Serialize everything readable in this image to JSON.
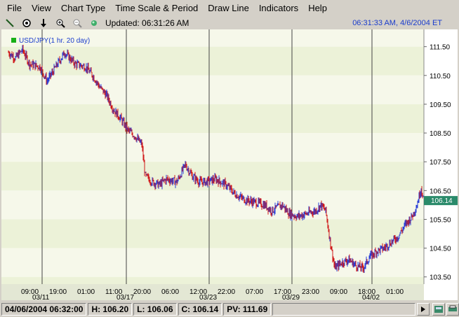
{
  "menu": [
    "File",
    "View",
    "Chart Type",
    "Time Scale & Period",
    "Draw Line",
    "Indicators",
    "Help"
  ],
  "toolbar": {
    "updated": "Updated: 06:31:26 AM",
    "clock": "06:31:33 AM, 4/6/2004 ET",
    "icons": [
      "draw-line-icon",
      "crosshair-icon",
      "down-arrow-icon",
      "zoom-in-icon",
      "zoom-out-icon",
      "refresh-icon"
    ]
  },
  "colors": {
    "accent": "#1a3ccc",
    "price_badge": "#2a8a6a",
    "up_bar": "#2b3fd6",
    "down_bar": "#d01818",
    "band_light": "#f6f8ea",
    "band_dark": "#ecf2d8"
  },
  "chart_data": {
    "type": "line",
    "legend": "USD/JPY(1 hr. 20 day)",
    "last_price": "106.14",
    "ylim": [
      103.25,
      112.1
    ],
    "y_ticks": [
      "111.50",
      "110.50",
      "109.50",
      "108.50",
      "107.50",
      "106.50",
      "105.50",
      "104.50",
      "103.50"
    ],
    "x_time_labels": [
      "09:00",
      "19:00",
      "01:00",
      "11:00",
      "20:00",
      "06:00",
      "12:00",
      "22:00",
      "07:00",
      "17:00",
      "23:00",
      "09:00",
      "18:00",
      "01:00"
    ],
    "x_date_labels": [
      "03/11",
      "03/17",
      "03/23",
      "03/29",
      "04/02"
    ],
    "series": [
      {
        "values": [
          [
            0,
            111.3
          ],
          [
            10,
            111.1
          ],
          [
            20,
            111.4
          ],
          [
            30,
            110.9
          ],
          [
            45,
            110.8
          ],
          [
            55,
            110.3
          ],
          [
            65,
            110.7
          ],
          [
            80,
            111.3
          ],
          [
            95,
            110.9
          ],
          [
            110,
            110.8
          ],
          [
            120,
            110.5
          ],
          [
            130,
            110.1
          ],
          [
            140,
            109.8
          ],
          [
            150,
            109.3
          ],
          [
            160,
            109.0
          ],
          [
            170,
            108.6
          ],
          [
            180,
            108.4
          ],
          [
            190,
            108.1
          ],
          [
            195,
            107.0
          ],
          [
            205,
            106.8
          ],
          [
            215,
            106.7
          ],
          [
            225,
            106.9
          ],
          [
            240,
            106.8
          ],
          [
            252,
            107.4
          ],
          [
            262,
            107.0
          ],
          [
            272,
            106.8
          ],
          [
            282,
            106.8
          ],
          [
            295,
            106.9
          ],
          [
            310,
            106.7
          ],
          [
            322,
            106.4
          ],
          [
            335,
            106.2
          ],
          [
            350,
            106.1
          ],
          [
            365,
            106.0
          ],
          [
            375,
            105.8
          ],
          [
            390,
            106.0
          ],
          [
            400,
            105.7
          ],
          [
            412,
            105.6
          ],
          [
            425,
            105.7
          ],
          [
            438,
            105.8
          ],
          [
            445,
            106.0
          ],
          [
            452,
            105.8
          ],
          [
            458,
            104.8
          ],
          [
            465,
            103.8
          ],
          [
            475,
            104.0
          ],
          [
            485,
            104.1
          ],
          [
            495,
            103.9
          ],
          [
            505,
            103.8
          ],
          [
            515,
            104.2
          ],
          [
            525,
            104.4
          ],
          [
            535,
            104.5
          ],
          [
            545,
            104.7
          ],
          [
            555,
            104.9
          ],
          [
            565,
            105.3
          ],
          [
            575,
            105.6
          ],
          [
            582,
            106.0
          ],
          [
            588,
            106.6
          ],
          [
            592,
            106.14
          ]
        ]
      }
    ]
  },
  "status": {
    "datetime": "04/06/2004 06:32:00",
    "high": "H: 106.20",
    "low": "L: 106.06",
    "close": "C: 106.14",
    "pv": "PV: 111.69"
  }
}
